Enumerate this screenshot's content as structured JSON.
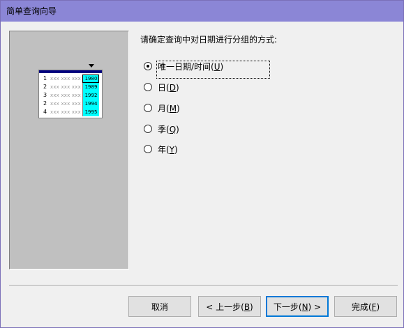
{
  "window": {
    "title": "简单查询向导"
  },
  "illustration": {
    "rows": [
      {
        "num": "1",
        "xxx": "xxx xxx xxx",
        "year": "1980"
      },
      {
        "num": "2",
        "xxx": "xxx xxx xxx",
        "year": "1989"
      },
      {
        "num": "3",
        "xxx": "xxx xxx xxx",
        "year": "1992"
      },
      {
        "num": "2",
        "xxx": "xxx xxx xxx",
        "year": "1994"
      },
      {
        "num": "4",
        "xxx": "xxx xxx xxx",
        "year": "1995"
      }
    ]
  },
  "prompt": "请确定查询中对日期进行分组的方式:",
  "options": [
    {
      "label": "唯一日期/时间(",
      "key": "U",
      "tail": ")",
      "checked": true
    },
    {
      "label": "日(",
      "key": "D",
      "tail": ")",
      "checked": false
    },
    {
      "label": "月(",
      "key": "M",
      "tail": ")",
      "checked": false
    },
    {
      "label": "季(",
      "key": "Q",
      "tail": ")",
      "checked": false
    },
    {
      "label": "年(",
      "key": "Y",
      "tail": ")",
      "checked": false
    }
  ],
  "buttons": {
    "cancel": "取消",
    "back": {
      "pre": "< 上一步(",
      "key": "B",
      "post": ")"
    },
    "next": {
      "pre": "下一步(",
      "key": "N",
      "post": ") >"
    },
    "finish": {
      "pre": "完成(",
      "key": "F",
      "post": ")"
    }
  }
}
